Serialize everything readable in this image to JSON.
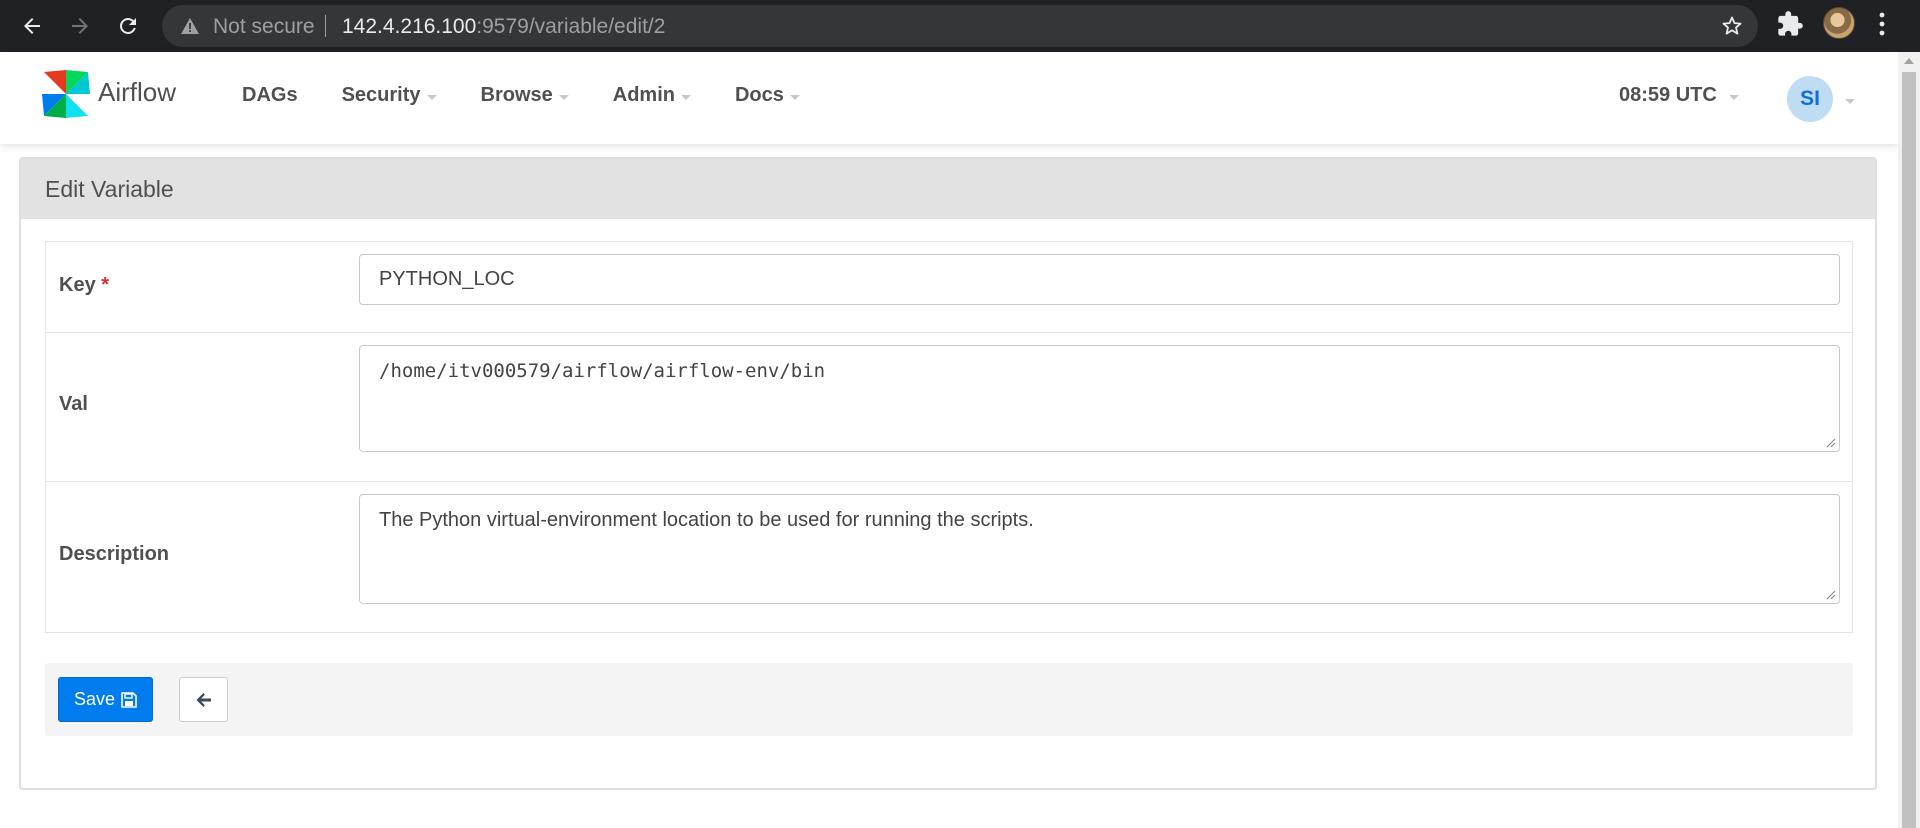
{
  "browser": {
    "not_secure_label": "Not secure",
    "url_host": "142.4.216.100",
    "url_path": ":9579/variable/edit/2",
    "icons": [
      "back-arrow-icon",
      "forward-arrow-icon",
      "reload-icon",
      "warning-triangle-icon",
      "star-icon",
      "puzzle-extension-icon",
      "profile-avatar",
      "kebab-menu-icon"
    ]
  },
  "navbar": {
    "brand": "Airflow",
    "menu": [
      {
        "label": "DAGs",
        "dropdown": false
      },
      {
        "label": "Security",
        "dropdown": true
      },
      {
        "label": "Browse",
        "dropdown": true
      },
      {
        "label": "Admin",
        "dropdown": true
      },
      {
        "label": "Docs",
        "dropdown": true
      }
    ],
    "clock": "08:59 UTC",
    "user_initials": "SI"
  },
  "panel": {
    "title": "Edit Variable"
  },
  "form": {
    "key": {
      "label": "Key",
      "required_mark": "*",
      "value": "PYTHON_LOC"
    },
    "val": {
      "label": "Val",
      "value": "/home/itv000579/airflow/airflow-env/bin"
    },
    "description": {
      "label": "Description",
      "value": "The Python virtual-environment location to be used for running the scripts."
    }
  },
  "actions": {
    "save_label": "Save"
  },
  "colors": {
    "chrome_bg": "#202124",
    "primary": "#017cee",
    "avatar_bg": "#bfdcf5",
    "panel_heading_bg": "#e2e2e2",
    "required": "#d9302c"
  }
}
